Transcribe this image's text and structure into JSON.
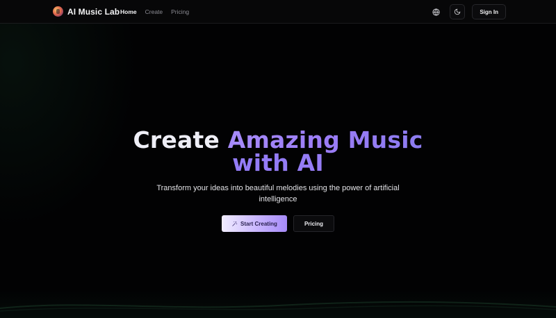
{
  "brand": {
    "name": "AI Music Lab",
    "logo_icon": "music-logo-icon"
  },
  "nav": {
    "links": [
      {
        "label": "Home",
        "active": true
      },
      {
        "label": "Create",
        "active": false
      },
      {
        "label": "Pricing",
        "active": false
      }
    ],
    "signin_label": "Sign In"
  },
  "hero": {
    "headline_plain": "Create",
    "headline_gradient": "Amazing Music",
    "headline_line2": "with AI",
    "subtitle": "Transform your ideas into beautiful melodies using the power of artificial intelligence",
    "start_label": "Start Creating",
    "pricing_label": "Pricing"
  },
  "colors": {
    "background": "#020203",
    "accent": "#9b7cf6",
    "cta_gradient_start": "#f1edff",
    "cta_gradient_end": "#a68af8"
  }
}
